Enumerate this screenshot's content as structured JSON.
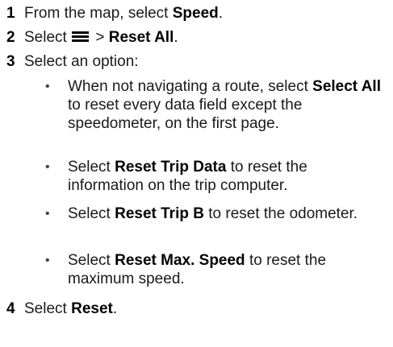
{
  "steps": [
    {
      "num": "1",
      "pre": "From the map, select ",
      "bold": "Speed",
      "post": "."
    },
    {
      "num": "2",
      "pre": "Select ",
      "sep": " > ",
      "bold": "Reset All",
      "post": "."
    },
    {
      "num": "3",
      "pre": "Select an option:"
    },
    {
      "num": "4",
      "pre": "Select ",
      "bold": "Reset",
      "post": "."
    }
  ],
  "step2_icon": "menu-icon",
  "bullets": [
    {
      "pre": "When not navigating a route, select ",
      "bold": "Select All",
      "post": " to reset every data field except the speedometer, on the first page."
    },
    {
      "pre": "Select ",
      "bold": "Reset Trip Data",
      "post": " to reset the information on the trip computer."
    },
    {
      "pre": "Select ",
      "bold": "Reset Trip B",
      "post": " to reset the odometer."
    },
    {
      "pre": "Select ",
      "bold": "Reset Max. Speed",
      "post": " to reset the maximum speed."
    }
  ],
  "bullet_glyph": "•"
}
